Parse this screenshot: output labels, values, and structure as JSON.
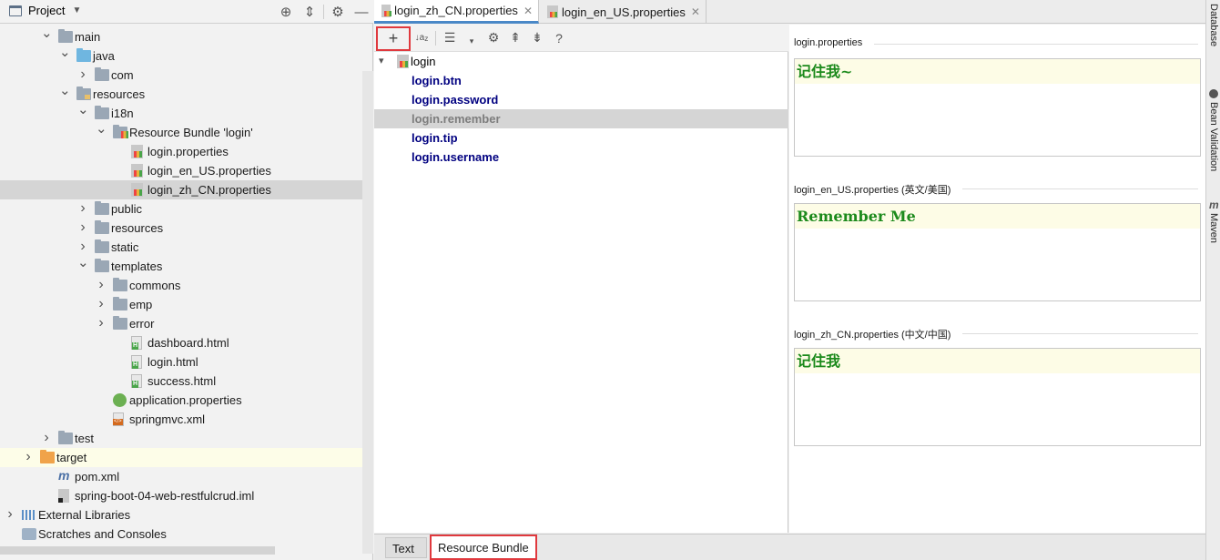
{
  "project_panel": {
    "title": "Project",
    "tree": [
      {
        "label": "main",
        "icon": "folder-icon",
        "depth": 2,
        "expanded": true
      },
      {
        "label": "java",
        "icon": "source-folder-icon",
        "depth": 3,
        "expanded": true
      },
      {
        "label": "com",
        "icon": "package-icon",
        "depth": 4,
        "expanded": false
      },
      {
        "label": "resources",
        "icon": "resources-folder-icon",
        "depth": 3,
        "expanded": true
      },
      {
        "label": "i18n",
        "icon": "folder-icon",
        "depth": 4,
        "expanded": true
      },
      {
        "label": "Resource Bundle 'login'",
        "icon": "resource-bundle-icon",
        "depth": 5,
        "expanded": true
      },
      {
        "label": "login.properties",
        "icon": "properties-file-icon",
        "depth": 6
      },
      {
        "label": "login_en_US.properties",
        "icon": "properties-file-icon",
        "depth": 6
      },
      {
        "label": "login_zh_CN.properties",
        "icon": "properties-file-icon",
        "depth": 6,
        "selected": true
      },
      {
        "label": "public",
        "icon": "folder-icon",
        "depth": 4,
        "expanded": false
      },
      {
        "label": "resources",
        "icon": "folder-icon",
        "depth": 4,
        "expanded": false
      },
      {
        "label": "static",
        "icon": "folder-icon",
        "depth": 4,
        "expanded": false
      },
      {
        "label": "templates",
        "icon": "folder-icon",
        "depth": 4,
        "expanded": true
      },
      {
        "label": "commons",
        "icon": "folder-icon",
        "depth": 5,
        "expanded": false
      },
      {
        "label": "emp",
        "icon": "folder-icon",
        "depth": 5,
        "expanded": false
      },
      {
        "label": "error",
        "icon": "folder-icon",
        "depth": 5,
        "expanded": false
      },
      {
        "label": "dashboard.html",
        "icon": "html-file-icon",
        "depth": 6
      },
      {
        "label": "login.html",
        "icon": "html-file-icon",
        "depth": 6
      },
      {
        "label": "success.html",
        "icon": "html-file-icon",
        "depth": 6
      },
      {
        "label": "application.properties",
        "icon": "spring-config-icon",
        "depth": 5
      },
      {
        "label": "springmvc.xml",
        "icon": "xml-file-icon",
        "depth": 5
      },
      {
        "label": "test",
        "icon": "folder-icon",
        "depth": 2,
        "expanded": false
      },
      {
        "label": "target",
        "icon": "excluded-folder-icon",
        "depth": 1,
        "expanded": false,
        "highlight": true
      },
      {
        "label": "pom.xml",
        "icon": "maven-icon",
        "depth": 2
      },
      {
        "label": "spring-boot-04-web-restfulcrud.iml",
        "icon": "iml-file-icon",
        "depth": 2
      },
      {
        "label": "External Libraries",
        "icon": "libraries-icon",
        "depth": 0,
        "expanded": false
      },
      {
        "label": "Scratches and Consoles",
        "icon": "scratches-icon",
        "depth": 0
      }
    ]
  },
  "editor_tabs": [
    {
      "label": "login_zh_CN.properties",
      "active": true
    },
    {
      "label": "login_en_US.properties",
      "active": false
    }
  ],
  "bundle_toolbar": {
    "add": "+",
    "help": "?"
  },
  "bundle": {
    "root": "login",
    "keys": [
      {
        "key": "login.btn",
        "selected": false
      },
      {
        "key": "login.password",
        "selected": false
      },
      {
        "key": "login.remember",
        "selected": true
      },
      {
        "key": "login.tip",
        "selected": false
      },
      {
        "key": "login.username",
        "selected": false
      }
    ]
  },
  "values": [
    {
      "file": "login.properties",
      "value": "记住我~"
    },
    {
      "file": "login_en_US.properties (英文/美国)",
      "value": "Remember Me"
    },
    {
      "file": "login_zh_CN.properties (中文/中国)",
      "value": "记住我"
    }
  ],
  "right_strip": [
    "Database",
    "Bean Validation",
    "Maven"
  ],
  "bottom_tabs": {
    "text": "Text",
    "resource_bundle": "Resource Bundle"
  }
}
